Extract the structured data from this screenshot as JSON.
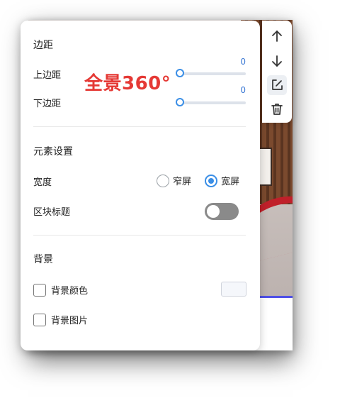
{
  "watermark": "全景360°",
  "margin_section": {
    "title": "边距",
    "top_label": "上边距",
    "top_value": "0",
    "top_level": 0,
    "bottom_label": "下边距",
    "bottom_value": "0",
    "bottom_level": 0
  },
  "element_section": {
    "title": "元素设置",
    "width_label": "宽度",
    "width_options": [
      "窄屏",
      "宽屏"
    ],
    "width_selected": "宽屏",
    "block_title_label": "区块标题",
    "block_title_enabled": false
  },
  "background_section": {
    "title": "背景",
    "color_label": "背景颜色",
    "color_checked": false,
    "color_value": "#f5f7fb",
    "image_label": "背景图片",
    "image_checked": false
  },
  "toolbar": {
    "items": [
      "arrow-up-icon",
      "arrow-down-icon",
      "edit-icon",
      "trash-icon"
    ]
  },
  "colors": {
    "accent": "#3a8ee6",
    "watermark": "#e53935",
    "preview_line": "#4f50e6"
  }
}
